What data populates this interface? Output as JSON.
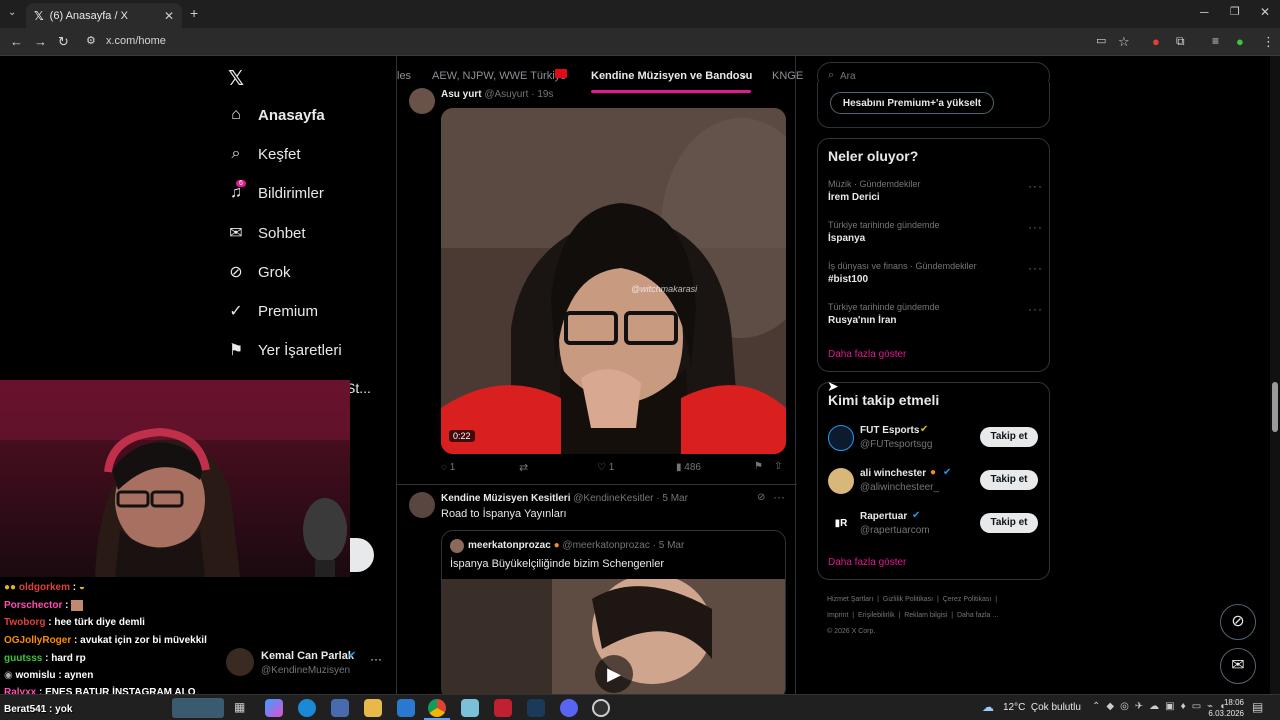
{
  "browser": {
    "tab_title": "(6) Anasayfa / X",
    "url": "x.com/home"
  },
  "nav": {
    "items": [
      {
        "label": "Anasayfa",
        "icon": "home-icon"
      },
      {
        "label": "Keşfet",
        "icon": "search-icon"
      },
      {
        "label": "Bildirimler",
        "icon": "bell-icon",
        "badge": "6"
      },
      {
        "label": "Sohbet",
        "icon": "mail-icon"
      },
      {
        "label": "Grok",
        "icon": "grok-icon"
      },
      {
        "label": "Premium",
        "icon": "premium-icon"
      },
      {
        "label": "Yer İşaretleri",
        "icon": "bookmark-icon"
      }
    ],
    "partial_text": "St...",
    "account_name": "Kemal Can Parlak",
    "account_handle": "@KendineMuzisyen"
  },
  "feed": {
    "tabs": [
      "les",
      "AEW, NJPW, WWE Türkiye",
      "Kendine Müzisyen ve Bandosu",
      "KNGE"
    ],
    "post1": {
      "author": "Asu yurt",
      "handle": "@Asuyurt",
      "time": "19s",
      "video_time": "0:22",
      "watermark": "@witchmakarasi",
      "replies": "1",
      "likes": "1",
      "views": "486"
    },
    "post2": {
      "author": "Kendine Müzisyen Kesitleri",
      "handle": "@KendineKesitler",
      "date": "5 Mar",
      "text": "Road to İspanya Yayınları",
      "quote_author": "meerkatonprozac",
      "quote_handle": "@meerkatonprozac",
      "quote_date": "5 Mar",
      "quote_text": "İspanya Büyükelçiliğinde bizim Schengenler"
    }
  },
  "sidebar": {
    "search_placeholder": "Ara",
    "premium_button": "Hesabını Premium+'a yükselt",
    "trends_title": "Neler oluyor?",
    "trends": [
      {
        "category": "Müzik · Gündemdekiler",
        "name": "İrem Derici"
      },
      {
        "category": "Türkiye tarihinde gündemde",
        "name": "İspanya"
      },
      {
        "category": "İş dünyası ve finans · Gündemdekiler",
        "name": "#bist100"
      },
      {
        "category": "Türkiye tarihinde gündemde",
        "name": "Rusya'nın İran"
      }
    ],
    "show_more": "Daha fazla göster",
    "follow_title": "Kimi takip etmeli",
    "follow": [
      {
        "name": "FUT Esports",
        "handle": "@FUTesportsgg",
        "button": "Takip et"
      },
      {
        "name": "ali winchester",
        "handle": "@aliwinchesteer_",
        "button": "Takip et"
      },
      {
        "name": "Rapertuar",
        "handle": "@rapertuarcom",
        "button": "Takip et"
      }
    ],
    "follow_more": "Daha fazla göster",
    "footer_links": [
      "Hizmet Şartları",
      "Gizlilik Politikası",
      "Çerez Politikası",
      "Imprint",
      "Erişilebilirlik",
      "Reklam bilgisi",
      "Daha fazla ..."
    ],
    "copyright": "© 2026 X Corp."
  },
  "chat": [
    {
      "user": "oldgorkem",
      "msg": ":",
      "color": "#e0403a"
    },
    {
      "user": "Porschector",
      "msg": ":",
      "color": "#ff4fb0"
    },
    {
      "user": "Twoborg",
      "msg": ": hee türk diye demli",
      "color": "#e0403a"
    },
    {
      "user": "OGJollyRoger",
      "msg": ": avukat için zor bi müvekkil",
      "color": "#ff8c00"
    },
    {
      "user": "guutsss",
      "msg": ": hard rp",
      "color": "#3ec43e"
    },
    {
      "user": "womislu",
      "msg": ": aynen",
      "color": "#ffffff"
    },
    {
      "user": "Ralyxx",
      "msg": ": ENES BATUR İNSTAGRAM ALO",
      "color": "#ff4fb0"
    },
    {
      "user": "Berat541",
      "msg": ": yok",
      "color": "#ffffff"
    }
  ],
  "taskbar": {
    "weather": "12°C  Çok bulutlu",
    "time": "18:06",
    "date": "6.03.2026"
  }
}
